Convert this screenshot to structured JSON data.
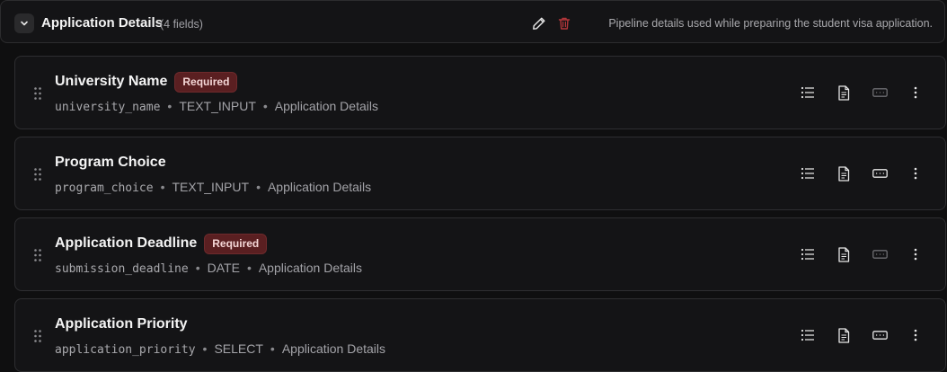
{
  "section": {
    "title": "Application Details",
    "count": "(4 fields)",
    "description": "Pipeline details used while preparing the student visa application."
  },
  "colors": {
    "background": "#0f0f10",
    "card": "#141416",
    "required_badge_bg": "#5a1f21",
    "trash": "#b3363a"
  },
  "fields": [
    {
      "label": "University Name",
      "required": true,
      "badge": "Required",
      "key": "university_name",
      "type": "TEXT_INPUT",
      "group": "Application Details",
      "separator": "•",
      "placeholder_toggle_active": false
    },
    {
      "label": "Program Choice",
      "required": false,
      "badge": "",
      "key": "program_choice",
      "type": "TEXT_INPUT",
      "group": "Application Details",
      "separator": "•",
      "placeholder_toggle_active": true
    },
    {
      "label": "Application Deadline",
      "required": true,
      "badge": "Required",
      "key": "submission_deadline",
      "type": "DATE",
      "group": "Application Details",
      "separator": "•",
      "placeholder_toggle_active": false
    },
    {
      "label": "Application Priority",
      "required": false,
      "badge": "",
      "key": "application_priority",
      "type": "SELECT",
      "group": "Application Details",
      "separator": "•",
      "placeholder_toggle_active": true
    }
  ],
  "icons": {
    "collapse": "chevron-down-icon",
    "edit": "pencil-icon",
    "delete": "trash-icon",
    "drag": "drag-handle-icon",
    "options": "list-icon",
    "details": "document-icon",
    "input": "input-field-icon",
    "more": "more-vertical-icon"
  }
}
